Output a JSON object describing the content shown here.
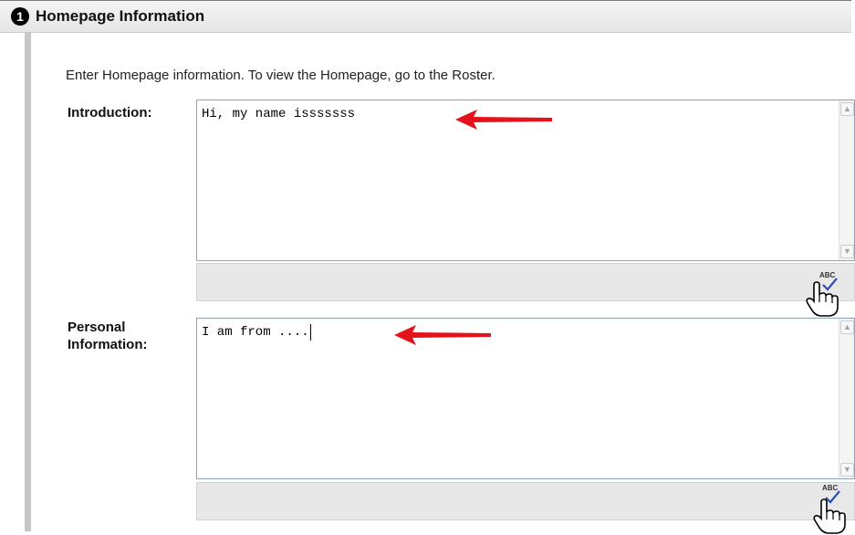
{
  "section": {
    "number": "1",
    "title": "Homepage Information"
  },
  "instructions": "Enter Homepage information. To view the Homepage, go to the Roster.",
  "fields": {
    "introduction": {
      "label": "Introduction:",
      "value": "Hi, my name isssssss"
    },
    "personal": {
      "label_line1": "Personal",
      "label_line2": "Information:",
      "value": "I am from ...."
    }
  },
  "spellcheck": {
    "label": "ABC"
  },
  "icons": [
    "spellcheck-icon",
    "hand-pointer-icon",
    "red-arrow-annotation",
    "scroll-up-icon",
    "scroll-down-icon"
  ],
  "colors": {
    "annotation_red": "#e4121a",
    "border_blue": "#8fa3b6",
    "toolbar_gray": "#e8e8e8"
  }
}
